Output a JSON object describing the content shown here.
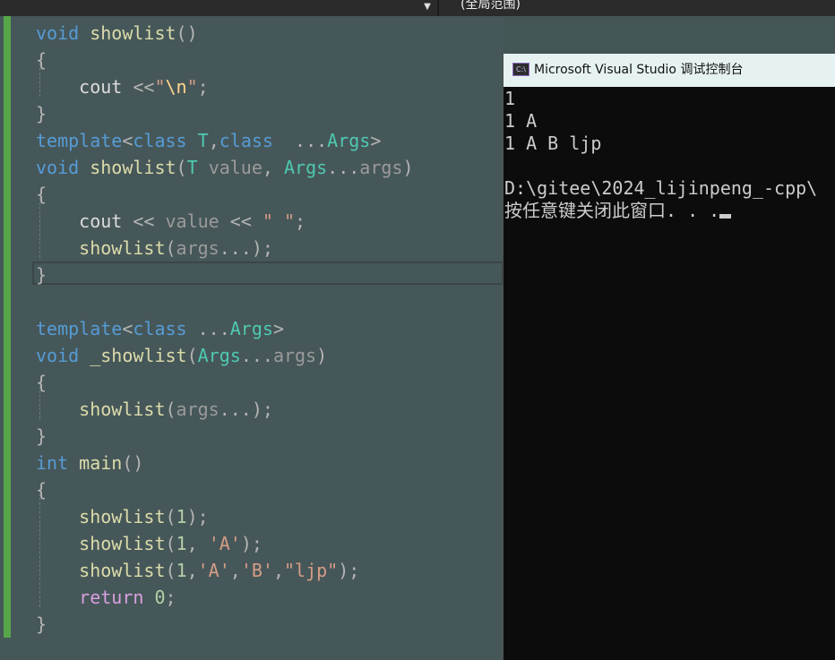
{
  "toolbar": {
    "dropdown_icon": "chevron-down-icon",
    "scope_label": "(全局范围)"
  },
  "editor": {
    "lines": [
      [
        [
          "kw",
          "void"
        ],
        [
          "txt",
          " "
        ],
        [
          "fn",
          "showlist"
        ],
        [
          "pun",
          "()"
        ]
      ],
      [
        [
          "pun",
          "{"
        ]
      ],
      [
        [
          "txt",
          "    cout "
        ],
        [
          "pun",
          "<<"
        ],
        [
          "str",
          "\""
        ],
        [
          "esc",
          "\\n"
        ],
        [
          "str",
          "\""
        ],
        [
          "pun",
          ";"
        ]
      ],
      [
        [
          "pun",
          "}"
        ]
      ],
      [
        [
          "kw",
          "template"
        ],
        [
          "pun",
          "<"
        ],
        [
          "kw",
          "class"
        ],
        [
          "txt",
          " "
        ],
        [
          "ty",
          "T"
        ],
        [
          "pun",
          ","
        ],
        [
          "kw",
          "class"
        ],
        [
          "txt",
          "  "
        ],
        [
          "pun",
          "..."
        ],
        [
          "ty",
          "Args"
        ],
        [
          "pun",
          ">"
        ]
      ],
      [
        [
          "kw",
          "void"
        ],
        [
          "txt",
          " "
        ],
        [
          "fn",
          "showlist"
        ],
        [
          "pun",
          "("
        ],
        [
          "ty",
          "T"
        ],
        [
          "txt",
          " "
        ],
        [
          "par",
          "value"
        ],
        [
          "pun",
          ", "
        ],
        [
          "ty",
          "Args"
        ],
        [
          "pun",
          "..."
        ],
        [
          "par",
          "args"
        ],
        [
          "pun",
          ")"
        ]
      ],
      [
        [
          "pun",
          "{"
        ]
      ],
      [
        [
          "txt",
          "    cout "
        ],
        [
          "pun",
          "<<"
        ],
        [
          "txt",
          " "
        ],
        [
          "par",
          "value"
        ],
        [
          "txt",
          " "
        ],
        [
          "pun",
          "<<"
        ],
        [
          "txt",
          " "
        ],
        [
          "str",
          "\" \""
        ],
        [
          "pun",
          ";"
        ]
      ],
      [
        [
          "txt",
          "    "
        ],
        [
          "fn",
          "showlist"
        ],
        [
          "pun",
          "("
        ],
        [
          "par",
          "args"
        ],
        [
          "pun",
          "...);"
        ]
      ],
      [
        [
          "pun",
          "}"
        ]
      ],
      [],
      [
        [
          "kw",
          "template"
        ],
        [
          "pun",
          "<"
        ],
        [
          "kw",
          "class"
        ],
        [
          "txt",
          " "
        ],
        [
          "pun",
          "..."
        ],
        [
          "ty",
          "Args"
        ],
        [
          "pun",
          ">"
        ]
      ],
      [
        [
          "kw",
          "void"
        ],
        [
          "txt",
          " "
        ],
        [
          "fn",
          "_showlist"
        ],
        [
          "pun",
          "("
        ],
        [
          "ty",
          "Args"
        ],
        [
          "pun",
          "..."
        ],
        [
          "par",
          "args"
        ],
        [
          "pun",
          ")"
        ]
      ],
      [
        [
          "pun",
          "{"
        ]
      ],
      [
        [
          "txt",
          "    "
        ],
        [
          "fn",
          "showlist"
        ],
        [
          "pun",
          "("
        ],
        [
          "par",
          "args"
        ],
        [
          "pun",
          "...);"
        ]
      ],
      [
        [
          "pun",
          "}"
        ]
      ],
      [
        [
          "kw",
          "int"
        ],
        [
          "txt",
          " "
        ],
        [
          "fn",
          "main"
        ],
        [
          "pun",
          "()"
        ]
      ],
      [
        [
          "pun",
          "{"
        ]
      ],
      [
        [
          "txt",
          "    "
        ],
        [
          "fn",
          "showlist"
        ],
        [
          "pun",
          "("
        ],
        [
          "num",
          "1"
        ],
        [
          "pun",
          ");"
        ]
      ],
      [
        [
          "txt",
          "    "
        ],
        [
          "fn",
          "showlist"
        ],
        [
          "pun",
          "("
        ],
        [
          "num",
          "1"
        ],
        [
          "pun",
          ", "
        ],
        [
          "str",
          "'A'"
        ],
        [
          "pun",
          ");"
        ]
      ],
      [
        [
          "txt",
          "    "
        ],
        [
          "fn",
          "showlist"
        ],
        [
          "pun",
          "("
        ],
        [
          "num",
          "1"
        ],
        [
          "pun",
          ","
        ],
        [
          "str",
          "'A'"
        ],
        [
          "pun",
          ","
        ],
        [
          "str",
          "'B'"
        ],
        [
          "pun",
          ","
        ],
        [
          "str",
          "\"ljp\""
        ],
        [
          "pun",
          ");"
        ]
      ],
      [
        [
          "txt",
          "    "
        ],
        [
          "kw2",
          "return"
        ],
        [
          "txt",
          " "
        ],
        [
          "num",
          "0"
        ],
        [
          "pun",
          ";"
        ]
      ],
      [
        [
          "pun",
          "}"
        ]
      ]
    ]
  },
  "console": {
    "icon": "console-app-icon",
    "icon_text": "C:\\",
    "title": "Microsoft Visual Studio 调试控制台",
    "output": [
      "1",
      "1 A",
      "1 A B ljp",
      "",
      "D:\\gitee\\2024_lijinpeng_-cpp\\",
      "按任意键关闭此窗口. . ."
    ]
  }
}
